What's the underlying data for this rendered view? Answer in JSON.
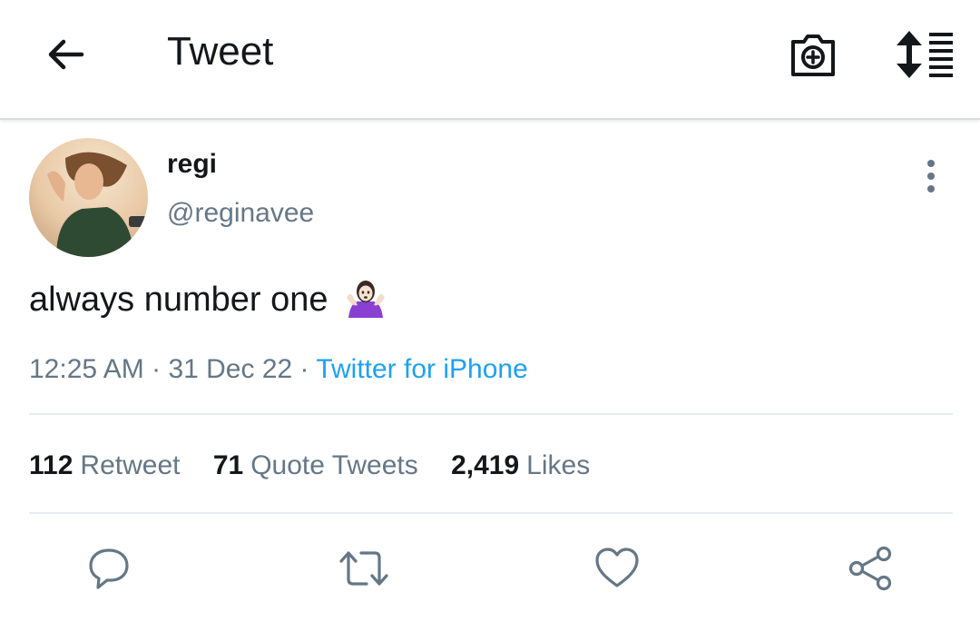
{
  "header": {
    "title": "Tweet",
    "icons": {
      "back": "arrow-left-icon",
      "camera": "camera-plus-icon",
      "sort": "sort-list-icon"
    }
  },
  "tweet": {
    "display_name": "regi",
    "handle": "@reginavee",
    "text": "always number one",
    "emoji": "🤷🏻‍♀️",
    "time": "12:25 AM",
    "date": "31 Dec 22",
    "separator": " · ",
    "source": "Twitter for iPhone"
  },
  "stats": [
    {
      "count": "112",
      "label": "Retweet"
    },
    {
      "count": "71",
      "label": "Quote Tweets"
    },
    {
      "count": "2,419",
      "label": "Likes"
    }
  ],
  "actions": [
    "reply-icon",
    "retweet-icon",
    "like-icon",
    "share-icon"
  ],
  "colors": {
    "text": "#14171a",
    "secondary": "#657786",
    "link": "#1da1f2",
    "icon": "#657786",
    "divider": "#e6ecf0"
  }
}
